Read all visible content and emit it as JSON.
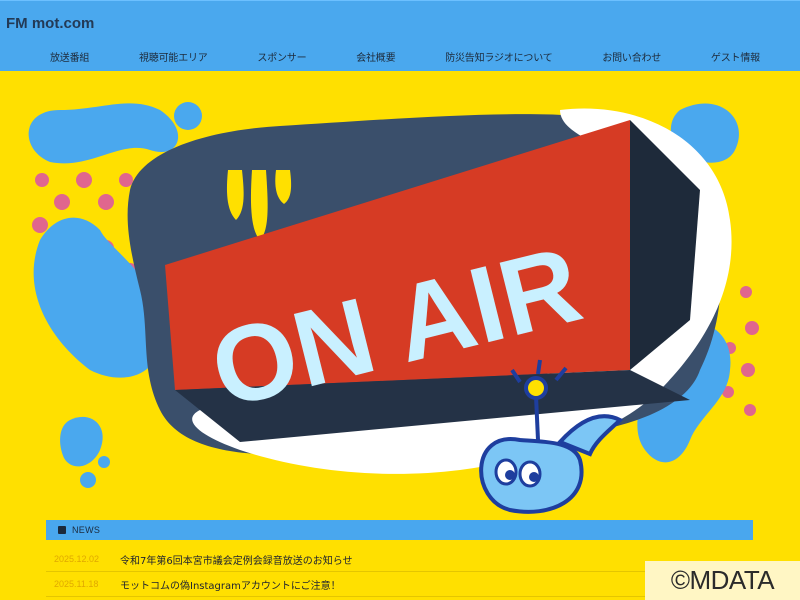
{
  "site": {
    "logo": "FM mot.com"
  },
  "nav": {
    "items": [
      {
        "label": "放送番組"
      },
      {
        "label": "視聴可能エリア"
      },
      {
        "label": "スポンサー"
      },
      {
        "label": "会社概要"
      },
      {
        "label": "防災告知ラジオについて"
      },
      {
        "label": "お問い合わせ"
      },
      {
        "label": "ゲスト情報"
      }
    ]
  },
  "hero": {
    "sign_text": "ON AIR"
  },
  "news": {
    "title": "NEWS",
    "items": [
      {
        "date": "2025.12.02",
        "text": "令和7年第6回本宮市議会定例会録音放送のお知らせ"
      },
      {
        "date": "2025.11.18",
        "text": "モットコムの偽Instagramアカウントにご注意！"
      }
    ]
  },
  "copyright": "©MDATA",
  "colors": {
    "background": "#ffe000",
    "header": "#4aa8ee",
    "news_bar": "#49a7ee",
    "sign_red": "#d63b24",
    "sign_text": "#c9f0ff",
    "dots": "#e0668e",
    "splash_blue": "#4aa8ee"
  }
}
